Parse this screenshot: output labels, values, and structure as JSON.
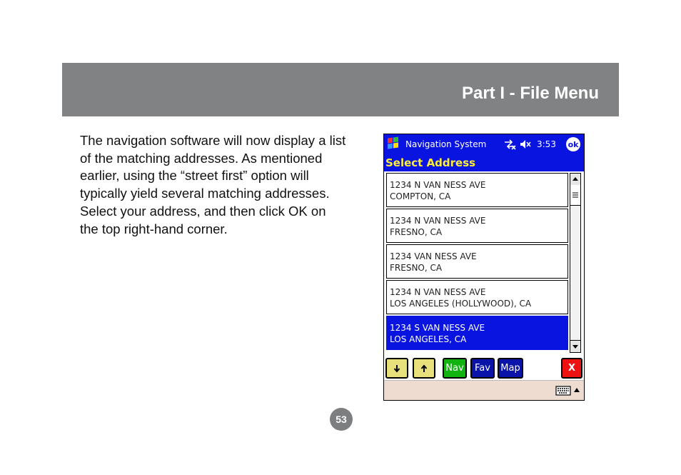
{
  "header": {
    "title": "Part I - File Menu",
    "color": "#808284"
  },
  "body_text": "The navigation software will now display a list of the matching addresses.  As mentioned earlier, using the “street first” option will typically yield several matching addresses.  Select your address, and then click OK on the top right-hand corner.",
  "page_number": "53",
  "pda": {
    "app_title": "Navigation System",
    "time": "3:53",
    "ok_label": "ok",
    "screen_title": "Select Address",
    "accent_color": "#0a14e0",
    "addresses": [
      {
        "line1": "1234 N VAN NESS AVE",
        "line2": "COMPTON, CA"
      },
      {
        "line1": "1234 N VAN NESS AVE",
        "line2": "FRESNO, CA"
      },
      {
        "line1": "1234 VAN NESS AVE",
        "line2": "FRESNO, CA"
      },
      {
        "line1": "1234 N VAN NESS AVE",
        "line2": "LOS ANGELES (HOLLYWOOD), CA"
      },
      {
        "line1": "1234 S VAN NESS AVE",
        "line2": "LOS ANGELES, CA"
      }
    ],
    "selected_index": 4,
    "buttons": {
      "down_icon": "arrow-down-icon",
      "up_icon": "arrow-up-icon",
      "nav": "Nav",
      "fav": "Fav",
      "map": "Map",
      "close": "X"
    },
    "icons": [
      "windows-start-icon",
      "sync-icon",
      "speaker-muted-icon",
      "keyboard-icon",
      "sip-arrow-icon"
    ]
  }
}
